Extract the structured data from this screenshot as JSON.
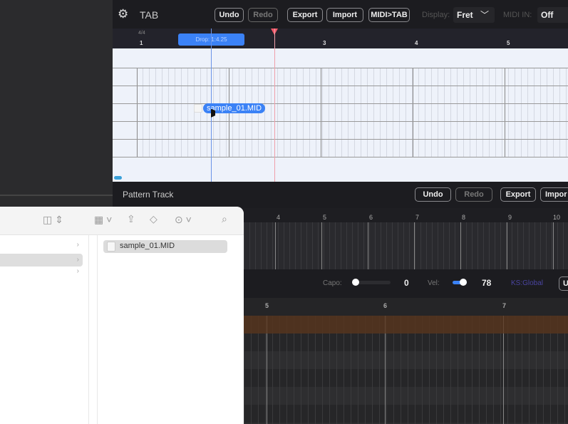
{
  "tab_panel": {
    "title": "TAB",
    "undo": "Undo",
    "redo": "Redo",
    "export": "Export",
    "import": "Import",
    "midi_to_tab": "MIDI>TAB",
    "display_label": "Display:",
    "display_value": "Fret",
    "midi_in_label": "MIDI IN:",
    "midi_in_value": "Off",
    "time_signature": "4/4",
    "drop_tooltip": "Drop: 1:4.25",
    "bar_numbers": [
      "1",
      "3",
      "4",
      "5"
    ],
    "drag_file": "sample_01.MID",
    "accent": "#3b82f6",
    "playhead_color": "#f05a6a"
  },
  "pattern_panel": {
    "title": "Pattern Track",
    "undo": "Undo",
    "redo": "Redo",
    "export": "Export",
    "import": "Impor",
    "ruler_numbers": [
      "4",
      "5",
      "6",
      "7",
      "8",
      "9",
      "10"
    ],
    "capo_label": "Capo:",
    "capo_value": "0",
    "vel_label": "Vel:",
    "vel_value": "78",
    "ks_label": "KS:Global",
    "extra_button": "U",
    "ruler2_numbers": [
      "5",
      "6",
      "7"
    ],
    "track_color": "#4a3020"
  },
  "finder": {
    "file": "sample_01.MID",
    "icons": [
      "columns-view-icon",
      "group-icon",
      "share-icon",
      "tag-icon",
      "more-icon",
      "search-icon"
    ]
  }
}
